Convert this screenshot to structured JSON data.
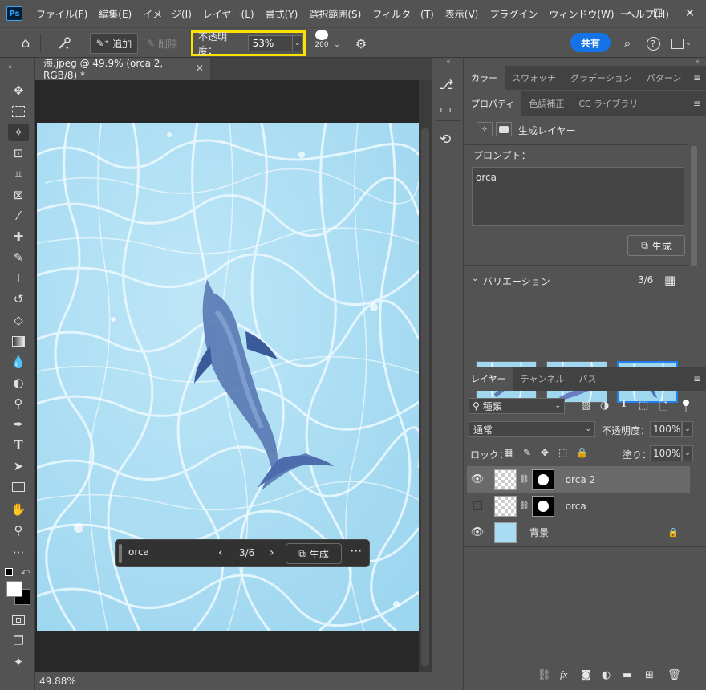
{
  "app": {
    "logo": "Ps",
    "menu": [
      "ファイル(F)",
      "編集(E)",
      "イメージ(I)",
      "レイヤー(L)",
      "書式(Y)",
      "選択範囲(S)",
      "フィルター(T)",
      "表示(V)",
      "プラグイン",
      "ウィンドウ(W)",
      "ヘルプ(H)"
    ],
    "window_buttons": [
      "—",
      "☐",
      "✕"
    ]
  },
  "options": {
    "add_label": "追加",
    "delete_label": "削除",
    "opacity_label": "不透明度：",
    "opacity_value": "53%",
    "brush_size": "200",
    "share_label": "共有",
    "highlight_color": "#ffe100",
    "accent_color": "#1473e6"
  },
  "document": {
    "tab_title": "海.jpeg @ 49.9% (orca 2, RGB/8) *",
    "zoom_status": "49.88%"
  },
  "contextual_bar": {
    "prompt": "orca",
    "counter": "3/6",
    "generate_label": "生成",
    "more": "···"
  },
  "panels": {
    "top_tabs": [
      "カラー",
      "スウォッチ",
      "グラデーション",
      "パターン"
    ],
    "prop_tabs": [
      "プロパティ",
      "色調補正",
      "CC ライブラリ"
    ],
    "layer_type_label": "生成レイヤー",
    "prompt_label": "プロンプト：",
    "prompt_value": "orca",
    "generate_label": "生成",
    "variations_label": "バリエーション",
    "variations_count": "3/6"
  },
  "layers": {
    "tabs": [
      "レイヤー",
      "チャンネル",
      "パス"
    ],
    "filter_label": "種類",
    "blend_mode": "通常",
    "opacity_label": "不透明度：",
    "opacity_value": "100%",
    "lock_label": "ロック：",
    "fill_label": "塗り：",
    "fill_value": "100%",
    "items": [
      {
        "name": "orca 2",
        "visible": true,
        "selected": true
      },
      {
        "name": "orca",
        "visible": false,
        "selected": false
      },
      {
        "name": "背景",
        "visible": true,
        "selected": false
      }
    ]
  }
}
